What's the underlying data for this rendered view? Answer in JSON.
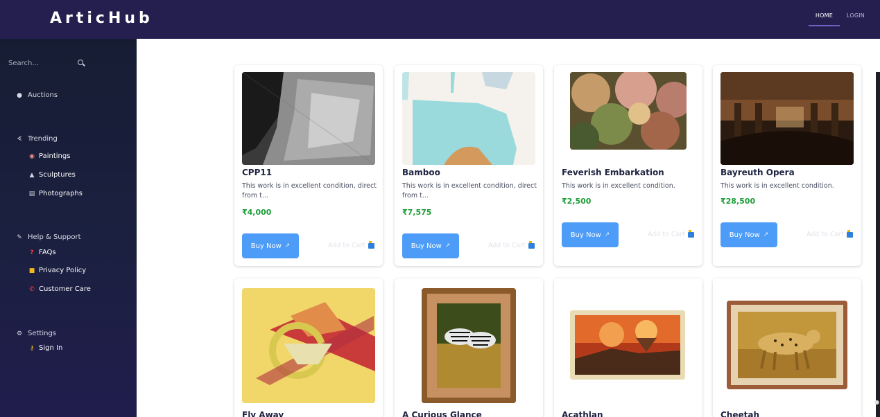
{
  "header": {
    "brand": "ArticHub",
    "nav": [
      {
        "label": "HOME",
        "active": true
      },
      {
        "label": "LOGIN",
        "active": false
      }
    ]
  },
  "sidebar": {
    "search_placeholder": "Search...",
    "auctions": "Auctions",
    "trending": {
      "label": "Trending",
      "items": [
        "Paintings",
        "Sculptures",
        "Photographs"
      ]
    },
    "help": {
      "label": "Help & Support",
      "items": [
        "FAQs",
        "Privacy Policy",
        "Customer Care"
      ]
    },
    "settings": {
      "label": "Settings",
      "items": [
        "Sign In"
      ]
    }
  },
  "cards": [
    {
      "title": "CPP11",
      "desc": "This work is in excellent condition, direct from t...",
      "price": "₹4,000",
      "buy": "Buy Now",
      "cart": "Add to Cart"
    },
    {
      "title": "Bamboo",
      "desc": "This work is in excellent condition, direct from t...",
      "price": "₹7,575",
      "buy": "Buy Now",
      "cart": "Add to Cart"
    },
    {
      "title": "Feverish Embarkation",
      "desc": "This work is in excellent condition.",
      "price": "₹2,500",
      "buy": "Buy Now",
      "cart": "Add to Cart"
    },
    {
      "title": "Bayreuth Opera",
      "desc": "This work is in excellent condition.",
      "price": "₹28,500",
      "buy": "Buy Now",
      "cart": "Add to Cart"
    },
    {
      "title": "Fly Away",
      "desc": "",
      "price": "",
      "buy": "",
      "cart": ""
    },
    {
      "title": "A Curious Glance",
      "desc": "",
      "price": "",
      "buy": "",
      "cart": ""
    },
    {
      "title": "Acathlan",
      "desc": "",
      "price": "",
      "buy": "",
      "cart": ""
    },
    {
      "title": "Cheetah",
      "desc": "",
      "price": "",
      "buy": "",
      "cart": ""
    }
  ],
  "colors": {
    "topbar": "#251f4f",
    "sidebar": "#1b2040",
    "buy_button": "#4d9cf8",
    "price": "#1f9d3a"
  }
}
